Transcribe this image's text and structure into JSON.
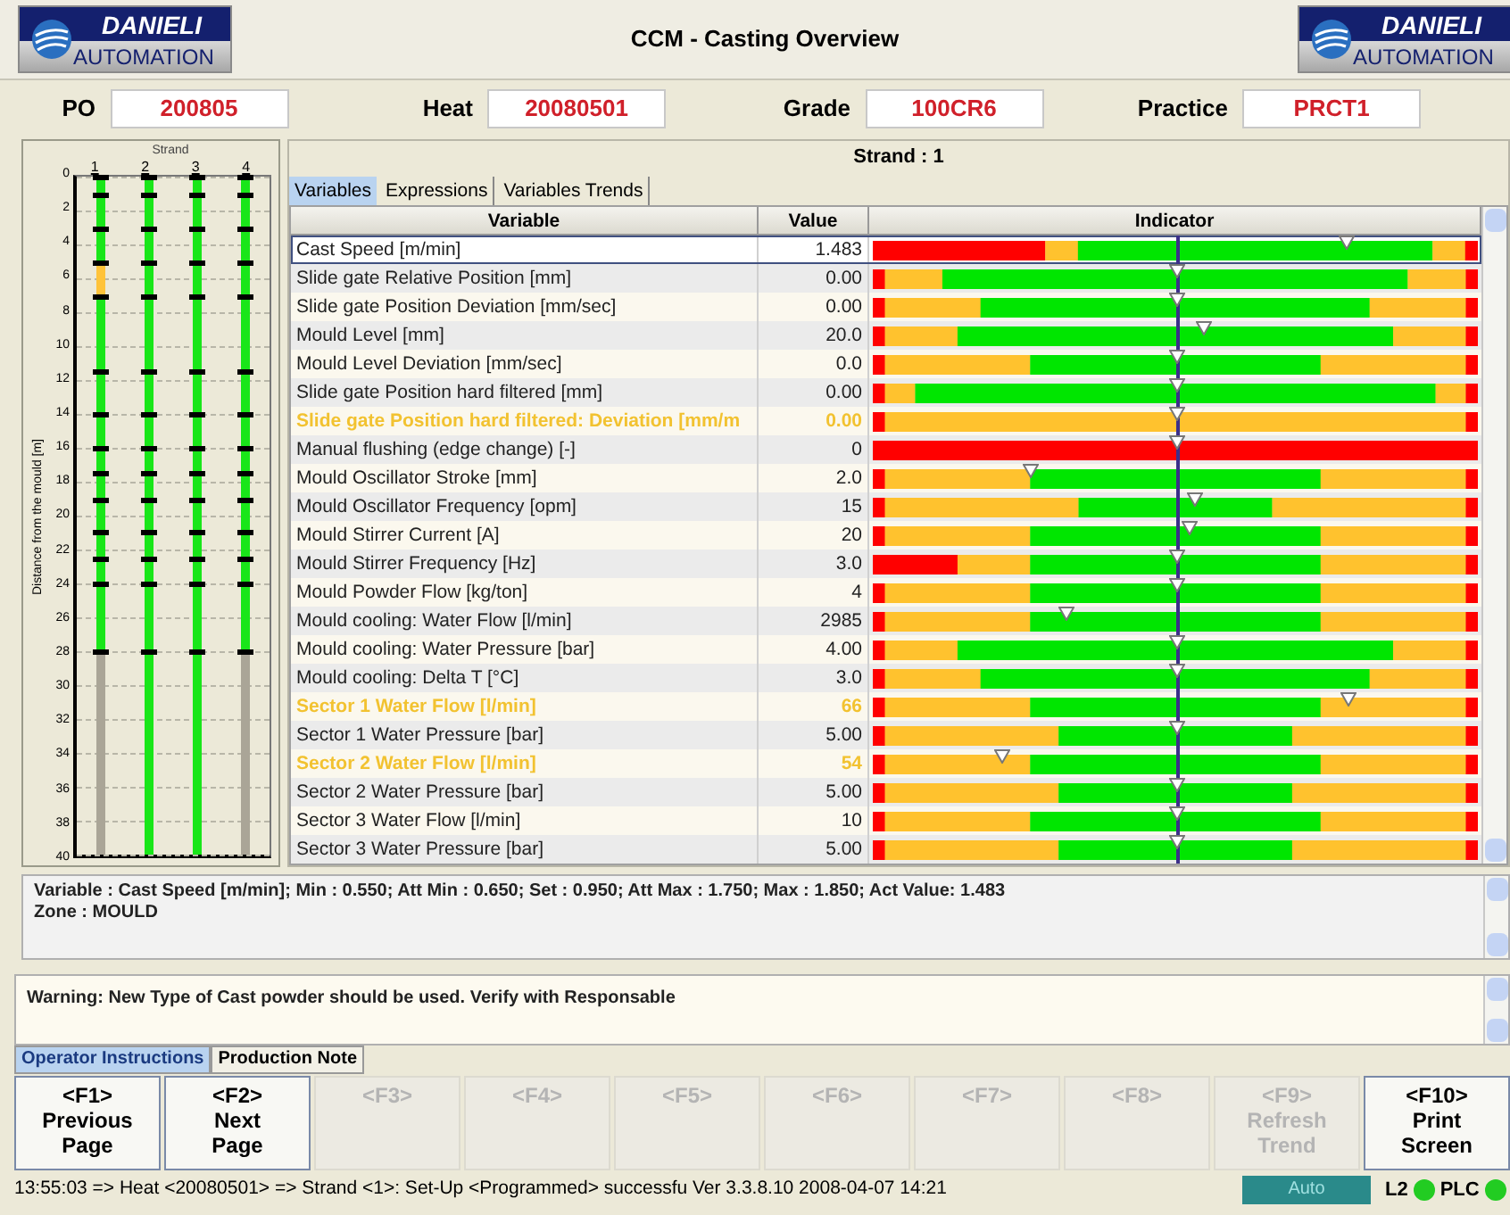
{
  "header": {
    "title": "CCM - Casting Overview",
    "logos": [
      {
        "line1": "DANIELI",
        "line2": "AUTOMATION"
      },
      {
        "line1": "DANIELI",
        "line2": "AUTOMATION"
      }
    ]
  },
  "fields": [
    {
      "label": "PO",
      "value": "200805"
    },
    {
      "label": "Heat",
      "value": "20080501"
    },
    {
      "label": "Grade",
      "value": "100CR6"
    },
    {
      "label": "Practice",
      "value": "PRCT1"
    }
  ],
  "strand_chart": {
    "title": "Strand",
    "axis_title": "Distance from the mould [m]",
    "y_ticks": [
      "0",
      "2",
      "4",
      "6",
      "8",
      "10",
      "12",
      "14",
      "16",
      "18",
      "20",
      "22",
      "24",
      "26",
      "28",
      "30",
      "32",
      "34",
      "36",
      "38",
      "40"
    ],
    "strands": [
      {
        "label": "1",
        "level": 0.7,
        "alarm": true
      },
      {
        "label": "2",
        "level": 1,
        "alarm": false
      },
      {
        "label": "3",
        "level": 1,
        "alarm": false
      },
      {
        "label": "4",
        "level": 0.7,
        "alarm": false
      }
    ]
  },
  "strand_title": "Strand : 1",
  "tabs": [
    {
      "label": "Variables",
      "selected": true
    },
    {
      "label": "Expressions",
      "selected": false
    },
    {
      "label": "Variables Trends",
      "selected": false
    }
  ],
  "table": {
    "columns": [
      "Variable",
      "Value",
      "Indicator"
    ],
    "rows": [
      {
        "variable": "Cast Speed [m/min]",
        "value": "1.483",
        "alarm": false,
        "selected": true,
        "kind": "speed",
        "level": 0.783
      },
      {
        "variable": "Slide gate Relative Position [mm]",
        "value": "0.00",
        "alarm": false,
        "selected": false,
        "kind": "wide",
        "level": 0.5
      },
      {
        "variable": "Slide gate Position Deviation [mm/sec]",
        "value": "0.00",
        "alarm": false,
        "selected": false,
        "kind": "medium",
        "level": 0.5
      },
      {
        "variable": "Mould Level [mm]",
        "value": "20.0",
        "alarm": false,
        "selected": false,
        "kind": "broad",
        "level": 0.547
      },
      {
        "variable": "Mould Level Deviation [mm/sec]",
        "value": "0.0",
        "alarm": false,
        "selected": false,
        "kind": "normal",
        "level": 0.5
      },
      {
        "variable": "Slide gate Position hard filtered [mm]",
        "value": "0.00",
        "alarm": false,
        "selected": false,
        "kind": "full",
        "level": 0.5
      },
      {
        "variable": "Slide gate Position hard filtered: Deviation [mm/m",
        "value": "0.00",
        "alarm": true,
        "selected": false,
        "kind": "warning",
        "level": 0.5
      },
      {
        "variable": "Manual flushing (edge change) [-]",
        "value": "0",
        "alarm": false,
        "selected": false,
        "kind": "fault",
        "level": 0.5
      },
      {
        "variable": "Mould Oscillator Stroke [mm]",
        "value": "2.0",
        "alarm": false,
        "selected": false,
        "kind": "normal",
        "level": 0.259
      },
      {
        "variable": "Mould Oscillator Frequency [opm]",
        "value": "15",
        "alarm": false,
        "selected": false,
        "kind": "narrow",
        "level": 0.531
      },
      {
        "variable": "Mould Stirrer Current [A]",
        "value": "20",
        "alarm": false,
        "selected": false,
        "kind": "normal",
        "level": 0.522
      },
      {
        "variable": "Mould Stirrer Frequency [Hz]",
        "value": "3.0",
        "alarm": false,
        "selected": false,
        "kind": "low",
        "level": 0.5
      },
      {
        "variable": "Mould Powder Flow [kg/ton]",
        "value": "4",
        "alarm": false,
        "selected": false,
        "kind": "normal",
        "level": 0.5
      },
      {
        "variable": "Mould cooling: Water Flow [l/min]",
        "value": "2985",
        "alarm": false,
        "selected": false,
        "kind": "normal",
        "level": 0.319
      },
      {
        "variable": "Mould cooling: Water Pressure  [bar]",
        "value": "4.00",
        "alarm": false,
        "selected": false,
        "kind": "broad",
        "level": 0.5
      },
      {
        "variable": "Mould cooling: Delta T  [°C]",
        "value": "3.0",
        "alarm": false,
        "selected": false,
        "kind": "medium",
        "level": 0.5
      },
      {
        "variable": "Sector 1 Water Flow  [l/min]",
        "value": "66",
        "alarm": true,
        "selected": false,
        "kind": "normal",
        "level": 0.785
      },
      {
        "variable": "Sector 1 Water Pressure [bar]",
        "value": "5.00",
        "alarm": false,
        "selected": false,
        "kind": "tight",
        "level": 0.5
      },
      {
        "variable": "Sector 2 Water Flow  [l/min]",
        "value": "54",
        "alarm": true,
        "selected": false,
        "kind": "normal",
        "level": 0.212
      },
      {
        "variable": "Sector 2 Water Pressure [bar]",
        "value": "5.00",
        "alarm": false,
        "selected": false,
        "kind": "tight",
        "level": 0.5
      },
      {
        "variable": "Sector 3 Water Flow  [l/min]",
        "value": "10",
        "alarm": false,
        "selected": false,
        "kind": "normal",
        "level": 0.5
      },
      {
        "variable": "Sector 3 Water Pressure [bar]",
        "value": "5.00",
        "alarm": false,
        "selected": false,
        "kind": "tight",
        "level": 0.5
      }
    ]
  },
  "details": [
    "Variable : Cast Speed [m/min]; Min : 0.550; Att Min : 0.650; Set : 0.950; Att Max : 1.750; Max : 1.850; Act Value: 1.483",
    "Zone : MOULD"
  ],
  "message": "Warning: New Type of Cast powder should be used. Verify with Responsable",
  "bottom_tabs": [
    {
      "label": "Operator Instructions",
      "selected": true
    },
    {
      "label": "Production Note",
      "selected": false
    }
  ],
  "function_keys": [
    {
      "key": "<F1>",
      "label_lines": [
        "Previous",
        "Page"
      ],
      "disabled": false
    },
    {
      "key": "<F2>",
      "label_lines": [
        "Next",
        "Page"
      ],
      "disabled": false
    },
    {
      "key": "<F3>",
      "disabled": true
    },
    {
      "key": "<F4>",
      "disabled": true
    },
    {
      "key": "<F5>",
      "disabled": true
    },
    {
      "key": "<F6>",
      "disabled": true
    },
    {
      "key": "<F7>",
      "disabled": true
    },
    {
      "key": "<F8>",
      "disabled": true
    },
    {
      "key": "<F9>",
      "label_lines": [
        "Refresh",
        "Trend"
      ],
      "disabled": true
    },
    {
      "key": "<F10>",
      "label_lines": [
        "Print",
        "Screen"
      ],
      "disabled": false
    }
  ],
  "status_bar": {
    "message": "13:55:03 => Heat <20080501> => Strand <1>: Set-Up <Programmed> successfu Ver 3.3.8.10 2008-04-07 14:21",
    "mode": "Auto",
    "links": [
      {
        "label": "L2",
        "on": true
      },
      {
        "label": "PLC",
        "on": true
      }
    ]
  }
}
